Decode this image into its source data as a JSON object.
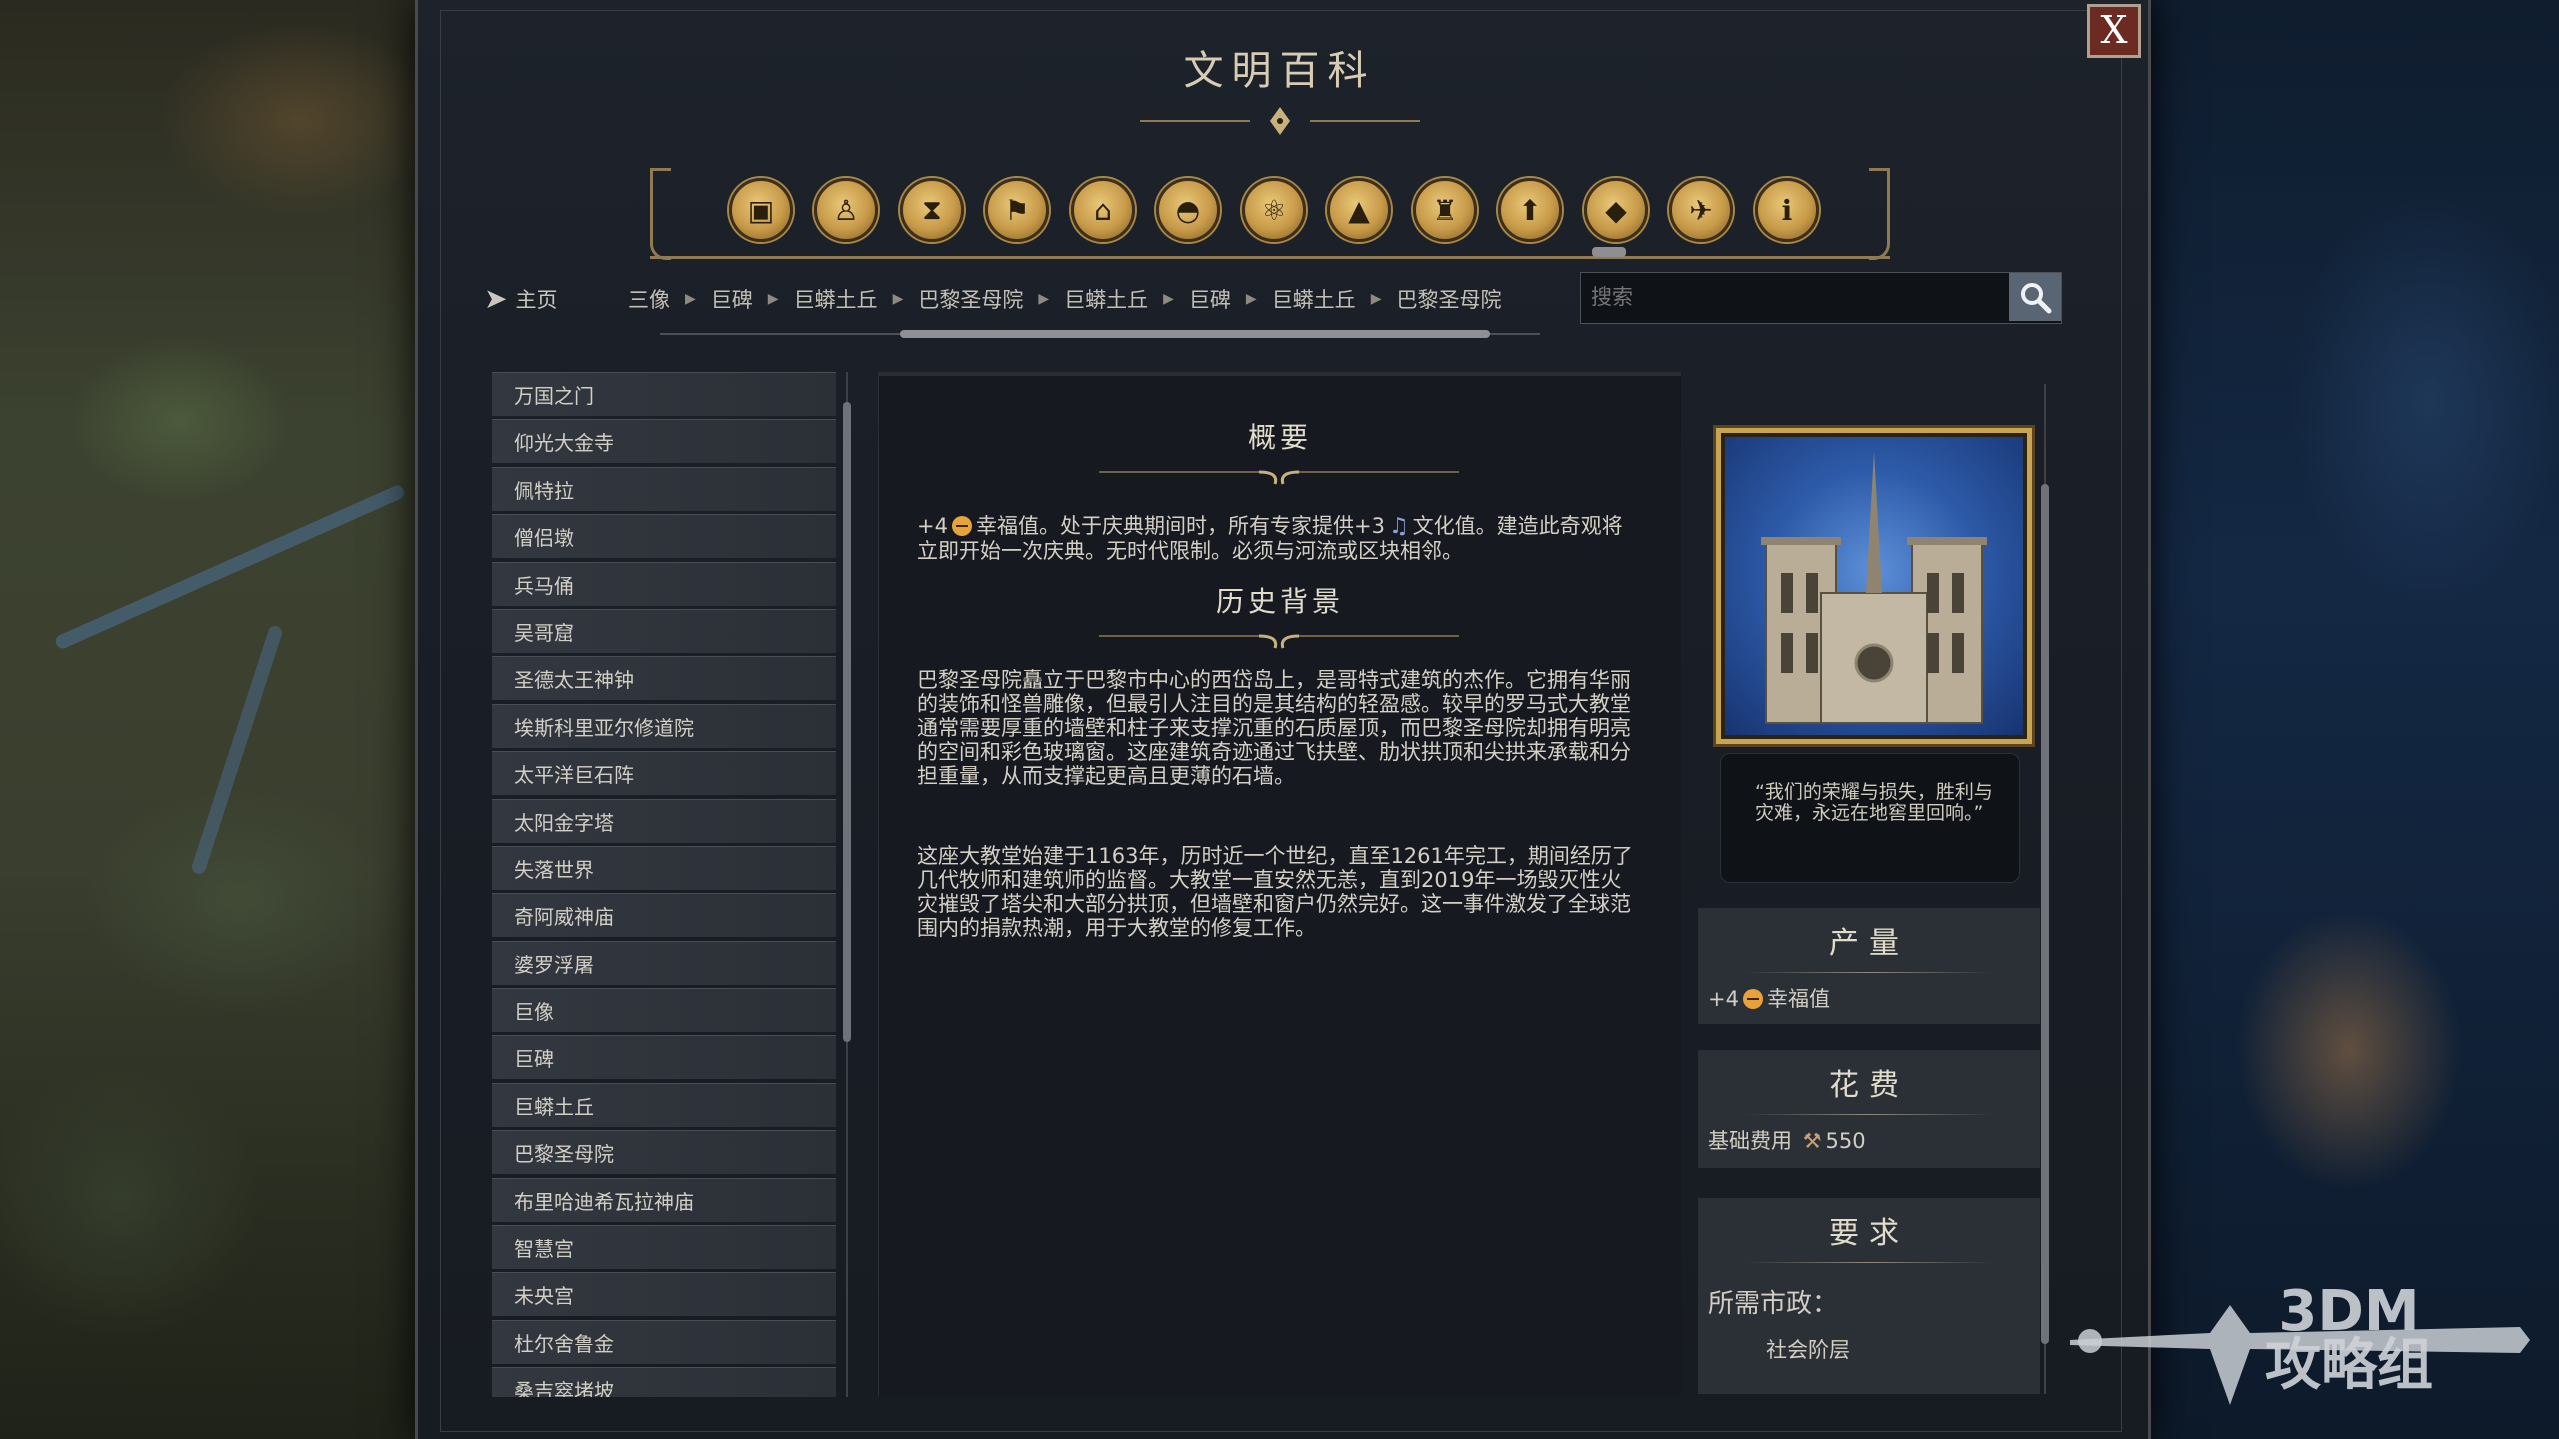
{
  "window": {
    "title": "文明百科",
    "close_label": "X"
  },
  "category_icons": [
    "units-icon",
    "great-people-icon",
    "hourglass-icon",
    "civilization-flag-icon",
    "government-icon",
    "religion-icon",
    "technology-icon",
    "terrain-icon",
    "city-state-icon",
    "promotion-icon",
    "wonders-icon",
    "dove-icon",
    "info-icon"
  ],
  "nav": {
    "home_label": "主页",
    "breadcrumbs": [
      "三像",
      "巨碑",
      "巨蟒土丘",
      "巴黎圣母院",
      "巨蟒土丘",
      "巨碑",
      "巨蟒土丘",
      "巴黎圣母院"
    ]
  },
  "search": {
    "placeholder": "搜索"
  },
  "list": [
    "万国之门",
    "仰光大金寺",
    "佩特拉",
    "僧侣墩",
    "兵马俑",
    "吴哥窟",
    "圣德太王神钟",
    "埃斯科里亚尔修道院",
    "太平洋巨石阵",
    "太阳金字塔",
    "失落世界",
    "奇阿威神庙",
    "婆罗浮屠",
    "巨像",
    "巨碑",
    "巨蟒土丘",
    "巴黎圣母院",
    "布里哈迪希瓦拉神庙",
    "智慧宫",
    "未央宫",
    "杜尔舍鲁金",
    "桑吉窣堵坡"
  ],
  "overview": {
    "title": "概要",
    "text_prefix": "+4",
    "text_happiness": "幸福值。处于庆典期间时，所有专家提供+3",
    "text_culture": "文化值。建造此奇观将立即开始一次庆典。无时代限制。必须与河流或区块相邻。"
  },
  "history": {
    "title": "历史背景",
    "p1": "巴黎圣母院矗立于巴黎市中心的西岱岛上，是哥特式建筑的杰作。它拥有华丽的装饰和怪兽雕像，但最引人注目的是其结构的轻盈感。较早的罗马式大教堂通常需要厚重的墙壁和柱子来支撑沉重的石质屋顶，而巴黎圣母院却拥有明亮的空间和彩色玻璃窗。这座建筑奇迹通过飞扶壁、肋状拱顶和尖拱来承载和分担重量，从而支撑起更高且更薄的石墙。",
    "p2": "这座大教堂始建于1163年，历时近一个世纪，直至1261年完工，期间经历了几代牧师和建筑师的监督。大教堂一直安然无恙，直到2019年一场毁灭性火灾摧毁了塔尖和大部分拱顶，但墙壁和窗户仍然完好。这一事件激发了全球范围内的捐款热潮，用于大教堂的修复工作。"
  },
  "sidebar": {
    "quote": "“我们的荣耀与损失，胜利与灾难，永远在地窖里回响。”",
    "production": {
      "title": "产量",
      "value": "+4",
      "label": "幸福值"
    },
    "cost": {
      "title": "花费",
      "label": "基础费用",
      "value": "550"
    },
    "requirements": {
      "title": "要求",
      "label": "所需市政：",
      "value": "社会阶层"
    }
  },
  "watermark": {
    "line1": "3DM",
    "line2": "攻略组"
  },
  "colors": {
    "accent_gold": "#c7a552",
    "happiness": "#e8a23a",
    "close_bg": "#6b2a22"
  }
}
